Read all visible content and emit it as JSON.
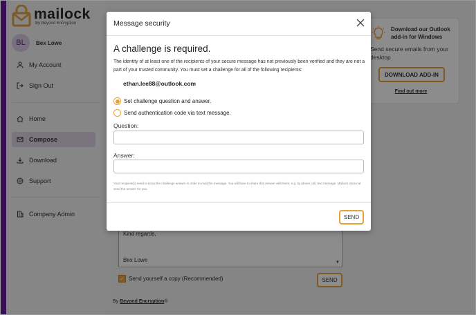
{
  "app": {
    "logo_name": "mailock",
    "logo_sub": "By Beyond Encryption"
  },
  "user": {
    "initials": "BL",
    "name": "Bex Lowe"
  },
  "sidebar": {
    "items": [
      {
        "label": "My Account",
        "icon": "person-icon"
      },
      {
        "label": "Sign Out",
        "icon": "sign-out-icon"
      },
      {
        "label": "Home",
        "icon": "home-icon"
      },
      {
        "label": "Compose",
        "icon": "compose-icon",
        "active": true
      },
      {
        "label": "Download",
        "icon": "download-icon"
      },
      {
        "label": "Support",
        "icon": "help-icon"
      },
      {
        "label": "Company Admin",
        "icon": "building-icon"
      }
    ]
  },
  "addin": {
    "title": "Download our Outlook add-in for Windows",
    "description": "Send secure emails from your desktop",
    "button_label": "DOWNLOAD ADD-IN",
    "link_label": "Find out more"
  },
  "compose": {
    "body_line1": "Kind regards,",
    "body_line2": "Bex Lowe",
    "copy_label": "Send yourself a copy (Recommended)",
    "send_label": "SEND"
  },
  "footer": {
    "prefix": "By ",
    "brand": "Beyond Encryption",
    "suffix": "®"
  },
  "modal": {
    "title": "Message security",
    "heading": "A challenge is required.",
    "description": "The identity of at least one of the recipients of your secure message has not previously been verified and they are not a part of your trusted community. You must set a challenge for all of the following recipients:",
    "recipient": "ethan.lee88@outlook.com",
    "option_question": "Set challenge question and answer.",
    "option_sms": "Send authentication code via text message.",
    "question_label": "Question:",
    "question_value": "",
    "answer_label": "Answer:",
    "answer_value": "",
    "note": "Your recipient(s) need to know the challenge answer in order to read the message. You will have to share that answer with them, e.g. by phone call, text message. Mailock does not send the answer for you.",
    "send_label": "SEND"
  },
  "colors": {
    "accent": "#e8a23a",
    "brand_purple": "#6a1b9a"
  }
}
